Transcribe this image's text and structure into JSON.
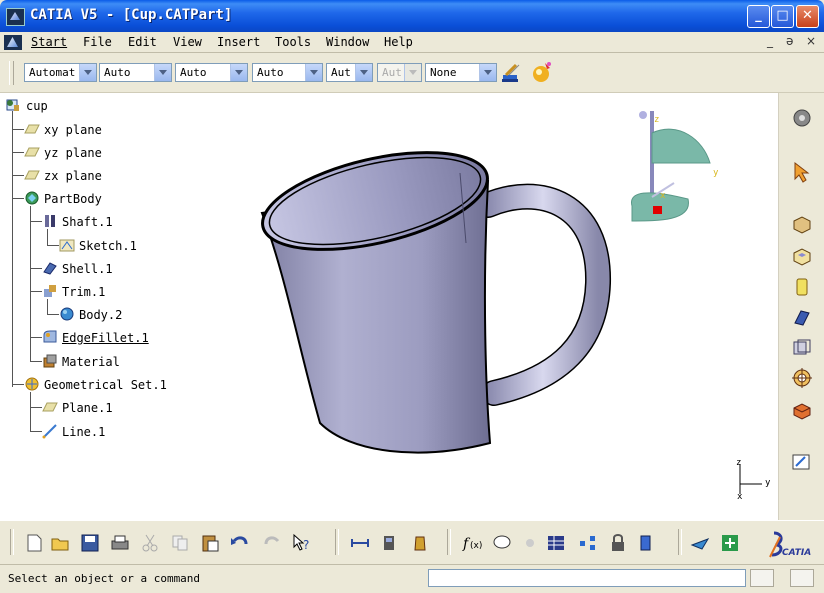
{
  "window": {
    "title": "CATIA V5 - [Cup.CATPart]",
    "minimize": "_",
    "maximize": "□",
    "close": "✕"
  },
  "menu": {
    "items": [
      "Start",
      "File",
      "Edit",
      "View",
      "Insert",
      "Tools",
      "Window",
      "Help"
    ]
  },
  "mdi": {
    "minimize": "_",
    "restore": "ǝ",
    "close": "×"
  },
  "graphic_props": {
    "combos": [
      {
        "value": "Automat",
        "enabled": true
      },
      {
        "value": "Auto",
        "enabled": true
      },
      {
        "value": "Auto",
        "enabled": true
      },
      {
        "value": "Auto",
        "enabled": true
      },
      {
        "value": "Aut",
        "enabled": true
      },
      {
        "value": "Aut",
        "enabled": false
      },
      {
        "value": "None",
        "enabled": true
      }
    ]
  },
  "tree": {
    "nodes": [
      {
        "label": "cup",
        "icon": "part-icon"
      },
      {
        "label": "xy plane",
        "icon": "plane-icon"
      },
      {
        "label": "yz plane",
        "icon": "plane-icon"
      },
      {
        "label": "zx plane",
        "icon": "plane-icon"
      },
      {
        "label": "PartBody",
        "icon": "partbody-icon"
      },
      {
        "label": "Shaft.1",
        "icon": "shaft-icon"
      },
      {
        "label": "Sketch.1",
        "icon": "sketch-icon"
      },
      {
        "label": "Shell.1",
        "icon": "shell-icon"
      },
      {
        "label": "Trim.1",
        "icon": "trim-icon"
      },
      {
        "label": "Body.2",
        "icon": "body-icon"
      },
      {
        "label": "EdgeFillet.1",
        "icon": "edgefillet-icon"
      },
      {
        "label": "Material",
        "icon": "material-icon"
      },
      {
        "label": "Geometrical Set.1",
        "icon": "geoset-icon"
      },
      {
        "label": "Plane.1",
        "icon": "plane-icon"
      },
      {
        "label": "Line.1",
        "icon": "line-icon"
      }
    ]
  },
  "compass": {
    "x": "x",
    "y": "y",
    "z": "z"
  },
  "axis_triad": {
    "x": "x",
    "y": "y",
    "z": "z"
  },
  "status": {
    "message": "Select an object or a command",
    "input_value": ""
  },
  "brand": {
    "logo_text": "CATIA"
  },
  "colors": {
    "title_blue": "#0a4fd8",
    "mug_body": "#a8a8c8",
    "mug_dark": "#6a6a8a",
    "compass_green": "#5aa898",
    "selection_red": "#e00000"
  }
}
